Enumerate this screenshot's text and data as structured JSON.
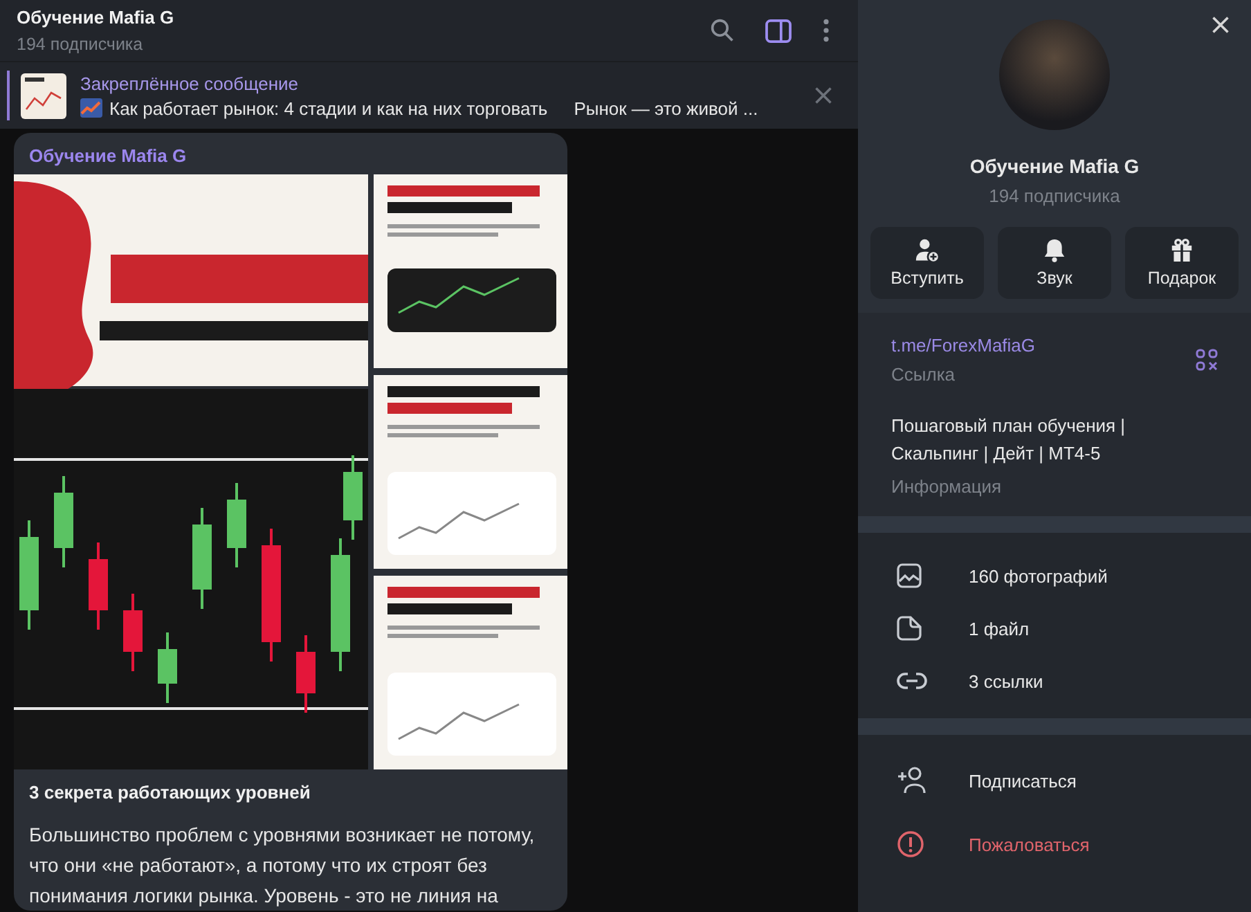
{
  "header": {
    "title": "Обучение Mafia G",
    "subtitle": "194 подписчика",
    "sidebar_toggle_on": true
  },
  "pinned": {
    "label": "Закреплённое сообщение",
    "text": "Как работает рынок: 4 стадии и как на них торговать",
    "preview": "Рынок — это живой ..."
  },
  "message": {
    "author": "Обучение Mafia G",
    "caption_title": "3 секрета работающих уровней",
    "body": "Большинство проблем с уровнями возникает не потому, что они «не работают», а потому что их строят без понимания логики рынка. Уровень - это не линия на"
  },
  "profile": {
    "name": "Обучение Mafia G",
    "subtitle": "194 подписчика",
    "buttons": [
      {
        "label": "Вступить",
        "kind": "join"
      },
      {
        "label": "Звук",
        "kind": "sound"
      },
      {
        "label": "Подарок",
        "kind": "gift"
      }
    ],
    "link": "t.me/ForexMafiaG",
    "link_label": "Ссылка",
    "description": "Пошаговый план обучения | Скальпинг | Дейт | MT4-5",
    "description_label": "Информация",
    "media": [
      {
        "label": "160 фотографий",
        "kind": "photos"
      },
      {
        "label": "1 файл",
        "kind": "files"
      },
      {
        "label": "3 ссылки",
        "kind": "links"
      }
    ],
    "actions": [
      {
        "label": "Подписаться",
        "kind": "subscribe",
        "danger": false
      },
      {
        "label": "Пожаловаться",
        "kind": "report",
        "danger": true
      }
    ]
  }
}
